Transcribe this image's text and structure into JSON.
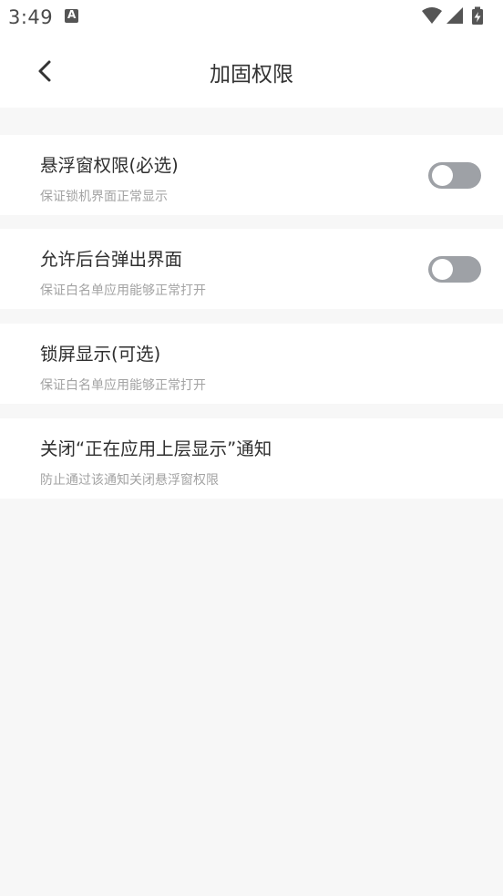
{
  "status_bar": {
    "time": "3:49",
    "notification_icon": "text-a-icon",
    "right_icons": [
      "wifi-icon",
      "cell-signal-icon",
      "battery-charging-icon"
    ]
  },
  "header": {
    "title": "加固权限",
    "back_icon": "chevron-left-icon"
  },
  "settings": [
    {
      "title": "悬浮窗权限(必选)",
      "subtitle": "保证锁机界面正常显示",
      "toggle": false
    },
    {
      "title": "允许后台弹出界面",
      "subtitle": "保证白名单应用能够正常打开",
      "toggle": false
    },
    {
      "title": "锁屏显示(可选)",
      "subtitle": "保证白名单应用能够正常打开"
    },
    {
      "title": "关闭“正在应用上层显示”通知",
      "subtitle": "防止通过该通知关闭悬浮窗权限"
    }
  ],
  "colors": {
    "page_background": "#f7f7f7",
    "card_background": "#ffffff",
    "toggle_off": "#9ea1a6",
    "subtitle_text": "#a3a3a3"
  }
}
